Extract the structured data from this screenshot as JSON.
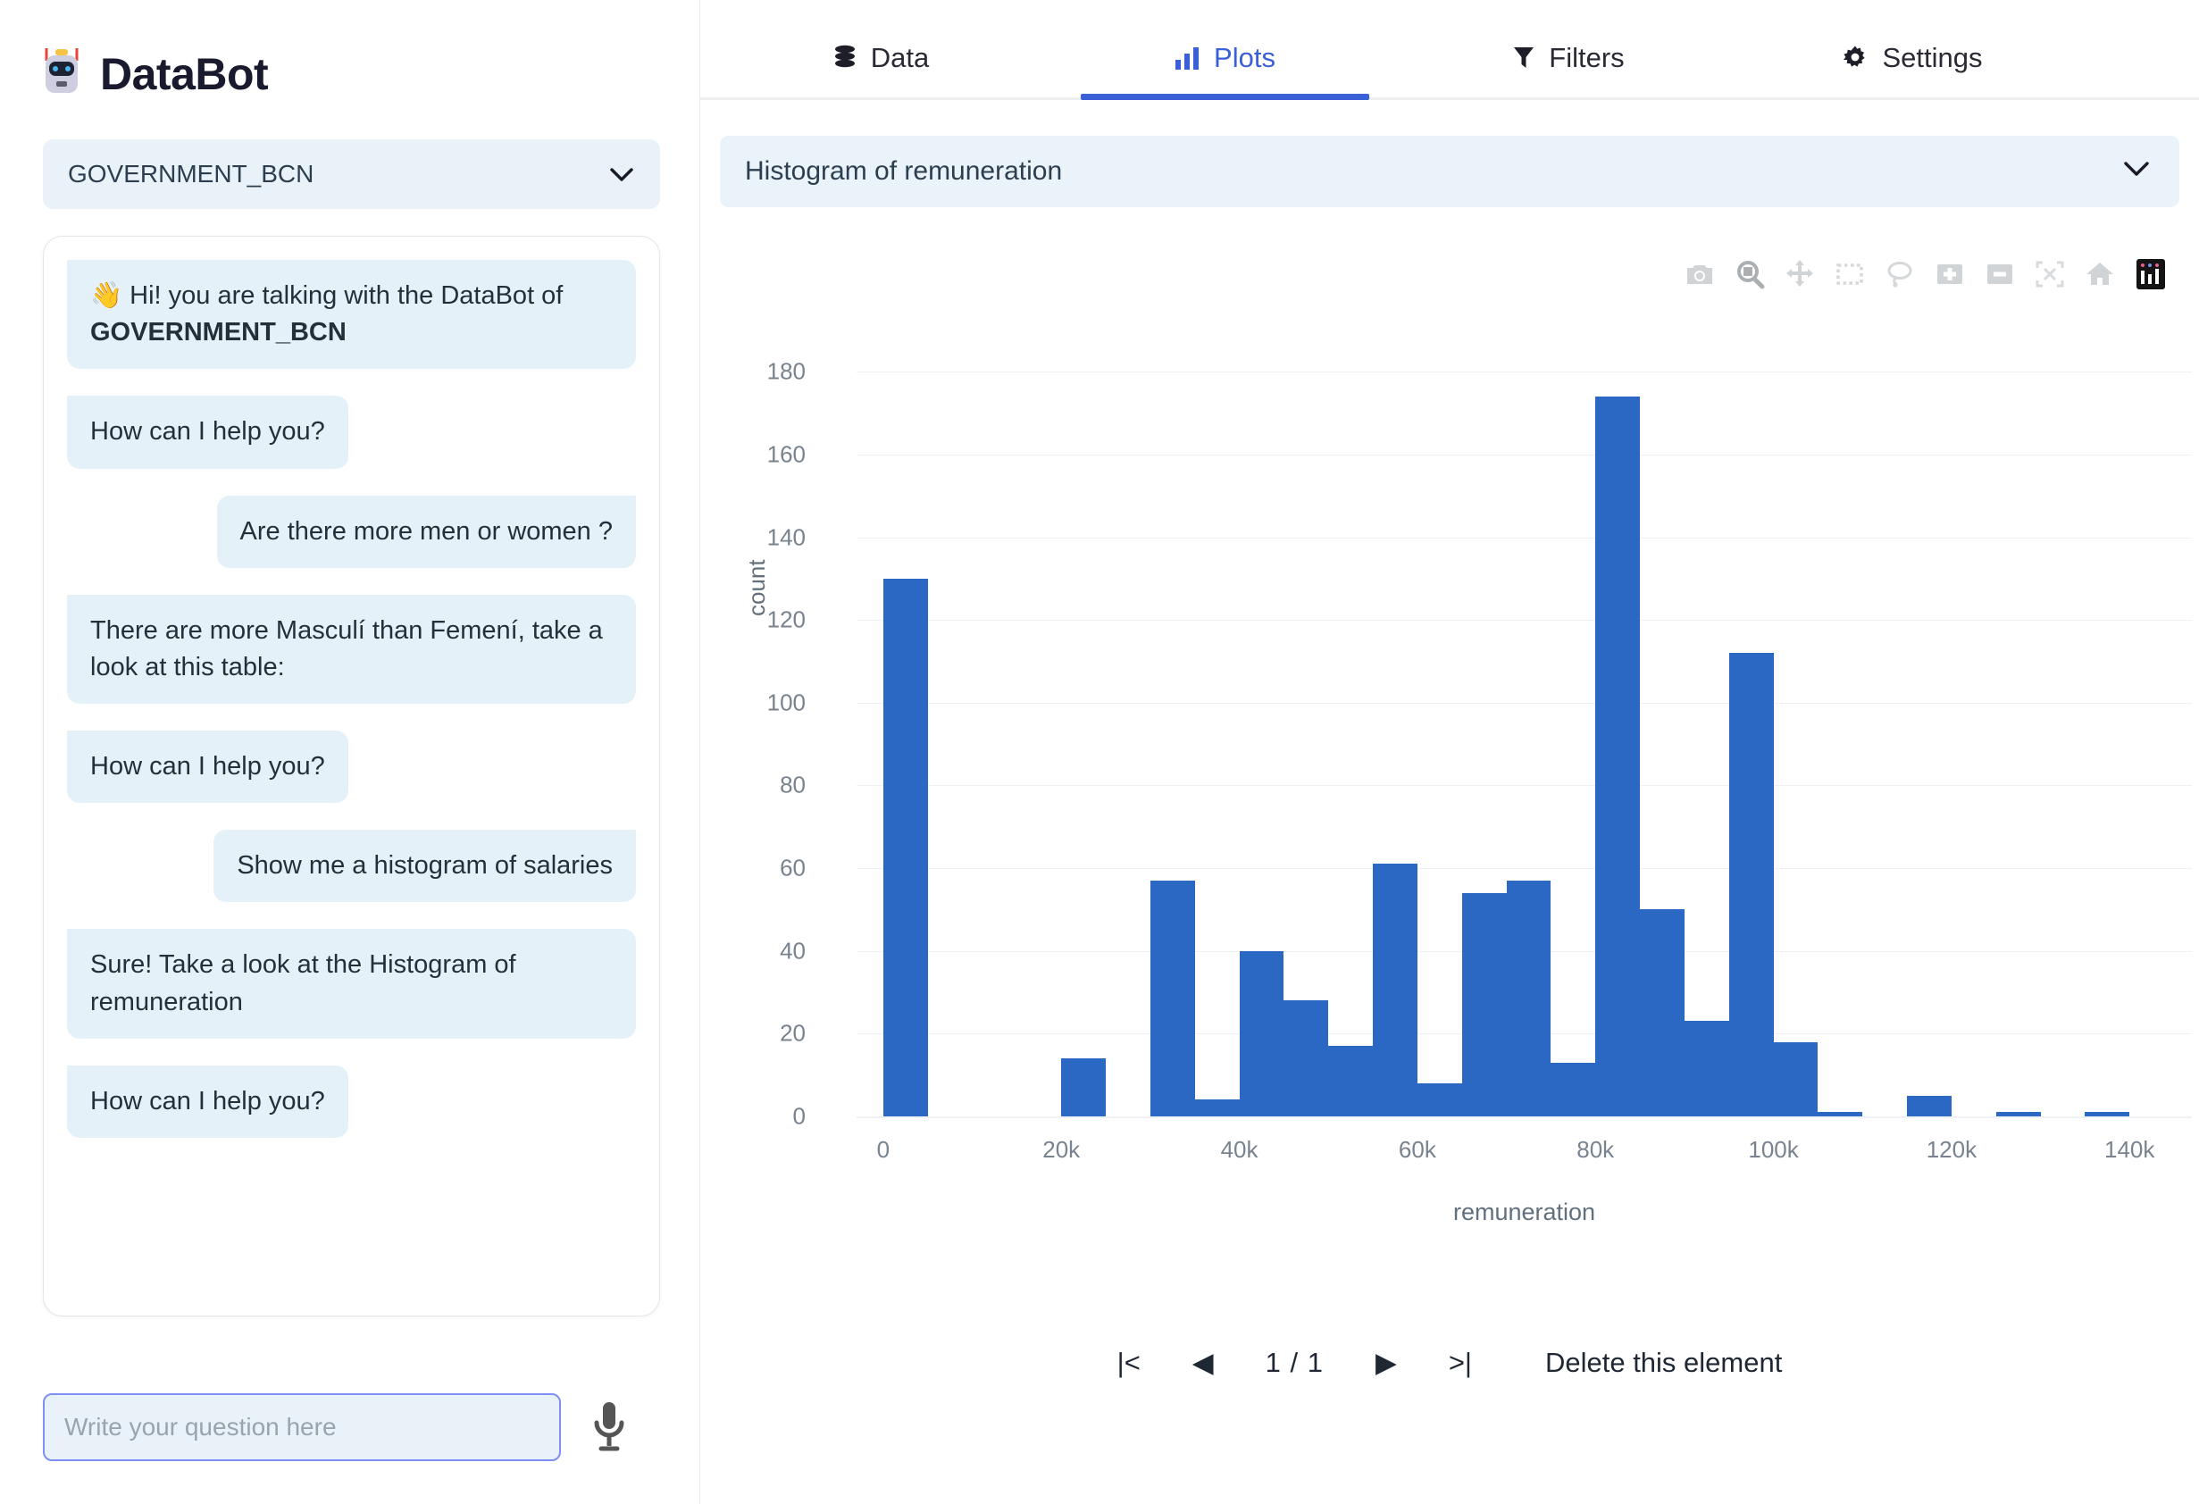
{
  "brand": {
    "title": "DataBot",
    "icon": "robot-icon",
    "emoji": "🤖"
  },
  "database_select": {
    "value": "GOVERNMENT_BCN",
    "chevron": "chevron-down-icon"
  },
  "tabs": [
    {
      "label": "Data",
      "icon": "database-icon",
      "active": false
    },
    {
      "label": "Plots",
      "icon": "bar-chart-icon",
      "active": true
    },
    {
      "label": "Filters",
      "icon": "funnel-icon",
      "active": false
    },
    {
      "label": "Settings",
      "icon": "gear-icon",
      "active": false
    }
  ],
  "plot_select": {
    "value": "Histogram of remuneration",
    "chevron": "chevron-down-icon"
  },
  "modebar": [
    "camera-icon",
    "zoom-icon",
    "pan-icon",
    "box-select-icon",
    "lasso-select-icon",
    "zoom-in-icon",
    "zoom-out-icon",
    "autoscale-icon",
    "reset-axes-home-icon",
    "plotly-logo-icon"
  ],
  "chat": {
    "messages": [
      {
        "from": "bot",
        "text": "👋 Hi! you are talking with the DataBot of ",
        "bold": "GOVERNMENT_BCN"
      },
      {
        "from": "bot",
        "text": "How can I help you?"
      },
      {
        "from": "user",
        "text": "Are there more men or women ?"
      },
      {
        "from": "bot",
        "text": "There are more Masculí than Femení, take a look at this table:"
      },
      {
        "from": "bot",
        "text": "How can I help you?"
      },
      {
        "from": "user",
        "text": "Show me a histogram of salaries"
      },
      {
        "from": "bot",
        "text": "Sure! Take a look at the Histogram of remuneration"
      },
      {
        "from": "bot",
        "text": "How can I help you?"
      }
    ]
  },
  "composer": {
    "placeholder": "Write your question here",
    "value": "",
    "mic_icon": "microphone-icon"
  },
  "pager": {
    "first": "|<",
    "prev": "◀",
    "page_text": "1 / 1",
    "next": "▶",
    "last": ">|",
    "delete_label": "Delete this element"
  },
  "colors": {
    "accent": "#3b5fd6",
    "bar": "#2b68c4",
    "bubble": "#e5f1f8",
    "select_bg": "#e8f2f8",
    "grid": "#eef1f5",
    "tick_text": "#78838f"
  },
  "chart_data": {
    "type": "bar",
    "title": "Histogram of remuneration",
    "xlabel": "remuneration",
    "ylabel": "count",
    "xlim": [
      -3000,
      147000
    ],
    "ylim": [
      0,
      190
    ],
    "xticks": [
      0,
      20000,
      40000,
      60000,
      80000,
      100000,
      120000,
      140000
    ],
    "xticklabels": [
      "0",
      "20k",
      "40k",
      "60k",
      "80k",
      "100k",
      "120k",
      "140k"
    ],
    "yticks": [
      0,
      20,
      40,
      60,
      80,
      100,
      120,
      140,
      160,
      180
    ],
    "yticklabels": [
      "0",
      "20",
      "40",
      "60",
      "80",
      "100",
      "120",
      "140",
      "160",
      "180"
    ],
    "grid": true,
    "legend": false,
    "bin_width": 5000,
    "bins": [
      {
        "x0": 0,
        "x1": 5000,
        "value": 130
      },
      {
        "x0": 5000,
        "x1": 10000,
        "value": 0
      },
      {
        "x0": 10000,
        "x1": 15000,
        "value": 0
      },
      {
        "x0": 15000,
        "x1": 20000,
        "value": 0
      },
      {
        "x0": 20000,
        "x1": 25000,
        "value": 14
      },
      {
        "x0": 25000,
        "x1": 30000,
        "value": 0
      },
      {
        "x0": 30000,
        "x1": 35000,
        "value": 57
      },
      {
        "x0": 35000,
        "x1": 40000,
        "value": 4
      },
      {
        "x0": 40000,
        "x1": 45000,
        "value": 40
      },
      {
        "x0": 45000,
        "x1": 50000,
        "value": 28
      },
      {
        "x0": 50000,
        "x1": 55000,
        "value": 17
      },
      {
        "x0": 55000,
        "x1": 60000,
        "value": 61
      },
      {
        "x0": 60000,
        "x1": 65000,
        "value": 8
      },
      {
        "x0": 65000,
        "x1": 70000,
        "value": 54
      },
      {
        "x0": 70000,
        "x1": 75000,
        "value": 57
      },
      {
        "x0": 75000,
        "x1": 80000,
        "value": 13
      },
      {
        "x0": 80000,
        "x1": 85000,
        "value": 174
      },
      {
        "x0": 85000,
        "x1": 90000,
        "value": 50
      },
      {
        "x0": 90000,
        "x1": 95000,
        "value": 23
      },
      {
        "x0": 95000,
        "x1": 100000,
        "value": 112
      },
      {
        "x0": 100000,
        "x1": 105000,
        "value": 18
      },
      {
        "x0": 105000,
        "x1": 110000,
        "value": 1
      },
      {
        "x0": 110000,
        "x1": 115000,
        "value": 0
      },
      {
        "x0": 115000,
        "x1": 120000,
        "value": 5
      },
      {
        "x0": 120000,
        "x1": 125000,
        "value": 0
      },
      {
        "x0": 125000,
        "x1": 130000,
        "value": 1
      },
      {
        "x0": 130000,
        "x1": 135000,
        "value": 0
      },
      {
        "x0": 135000,
        "x1": 140000,
        "value": 1
      }
    ]
  }
}
